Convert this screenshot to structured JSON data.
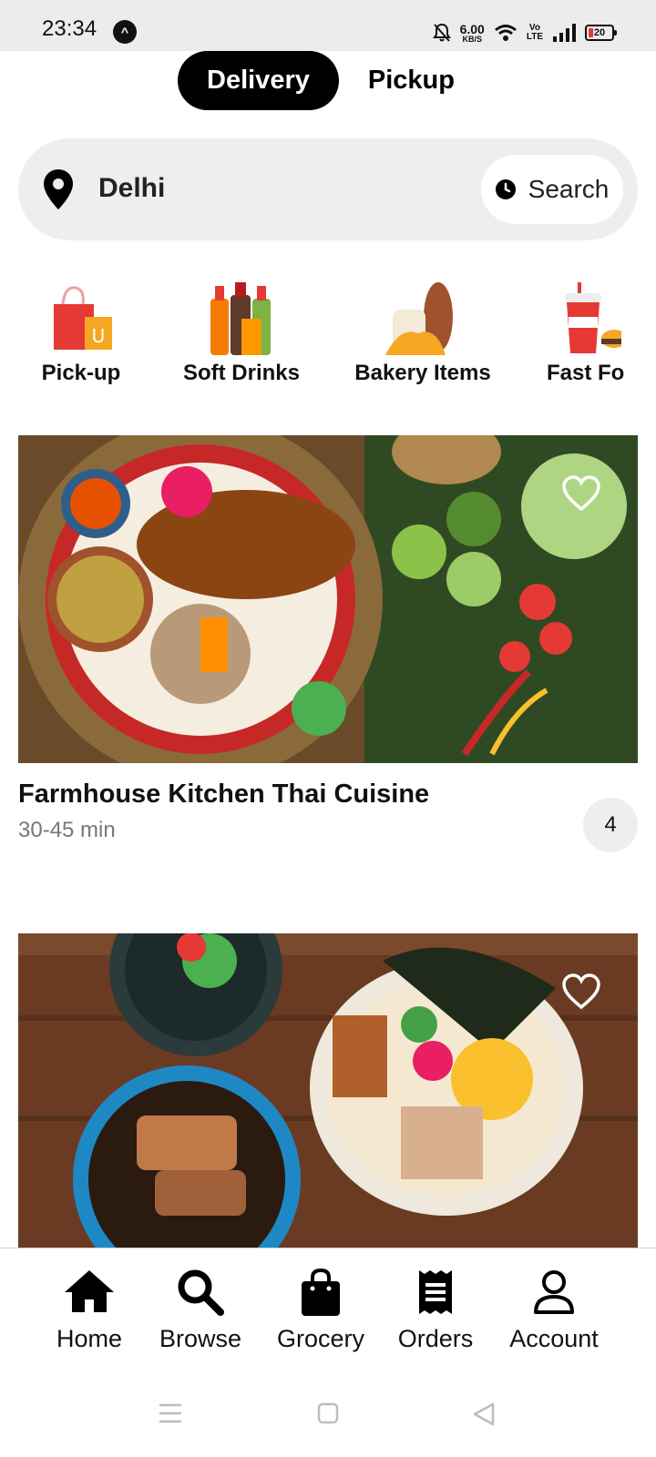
{
  "status_bar": {
    "time": "23:34",
    "app_icon_glyph": "^",
    "net_speed_value": "6.00",
    "net_speed_unit": "KB/S",
    "volte_top": "Vo",
    "volte_bottom": "LTE",
    "battery_level": "20"
  },
  "mode_toggle": {
    "delivery_label": "Delivery",
    "pickup_label": "Pickup",
    "selected": "Delivery"
  },
  "search": {
    "location": "Delhi",
    "search_label": "Search"
  },
  "categories": [
    {
      "label": "Pick-up",
      "icon": "shopping-bag-icon"
    },
    {
      "label": "Soft Drinks",
      "icon": "soft-drinks-icon"
    },
    {
      "label": "Bakery Items",
      "icon": "bread-icon"
    },
    {
      "label": "Fast Fo",
      "icon": "fast-food-icon"
    }
  ],
  "restaurants": [
    {
      "name": "Farmhouse Kitchen Thai Cuisine",
      "time": "30-45 min",
      "rating": "4"
    },
    {
      "name": "",
      "time": "",
      "rating": ""
    }
  ],
  "bottom_nav": [
    {
      "label": "Home",
      "icon": "home-icon"
    },
    {
      "label": "Browse",
      "icon": "search-icon"
    },
    {
      "label": "Grocery",
      "icon": "grocery-bag-icon"
    },
    {
      "label": "Orders",
      "icon": "receipt-icon"
    },
    {
      "label": "Account",
      "icon": "account-icon"
    }
  ],
  "colors": {
    "accent": "#000000",
    "surface": "#eeeeee",
    "muted_text": "#777777"
  }
}
